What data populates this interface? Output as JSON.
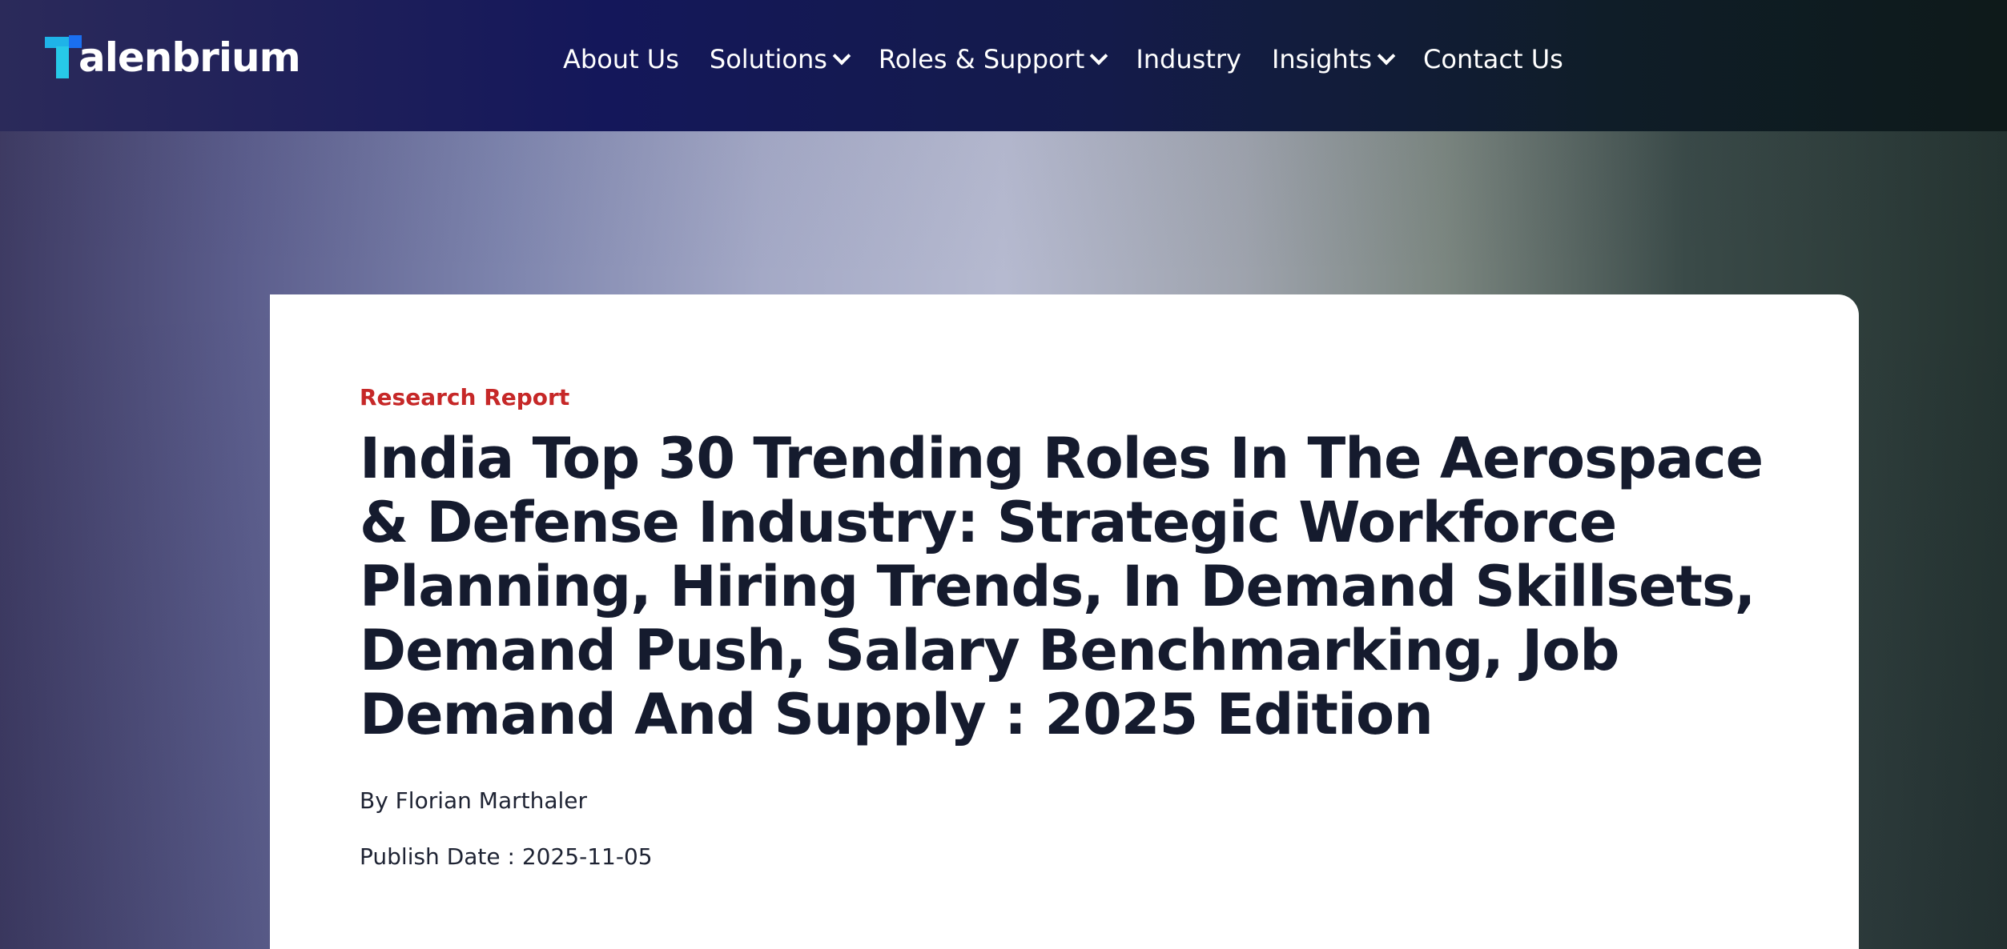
{
  "brand": {
    "name": "Talenbrium",
    "logo_text": "alenbrium",
    "colors": {
      "logo_primary": "#27c9e8",
      "logo_accent": "#1a6ff0",
      "category": "#c62828",
      "title": "#151b2e"
    }
  },
  "nav": {
    "items": [
      {
        "label": "About Us",
        "has_dropdown": false
      },
      {
        "label": "Solutions",
        "has_dropdown": true
      },
      {
        "label": "Roles & Support",
        "has_dropdown": true
      },
      {
        "label": "Industry",
        "has_dropdown": false
      },
      {
        "label": "Insights",
        "has_dropdown": true
      },
      {
        "label": "Contact Us",
        "has_dropdown": false
      }
    ],
    "dropdown_icon": "chevron-down-icon"
  },
  "article": {
    "category": "Research Report",
    "title": "India Top 30 Trending Roles In The Aerospace & Defense Industry: Strategic Workforce Planning, Hiring Trends, In Demand Skillsets, Demand Push, Salary Benchmarking, Job Demand And Supply : 2025 Edition",
    "author": "By Florian Marthaler",
    "publish_date": "Publish Date : 2025-11-05"
  }
}
